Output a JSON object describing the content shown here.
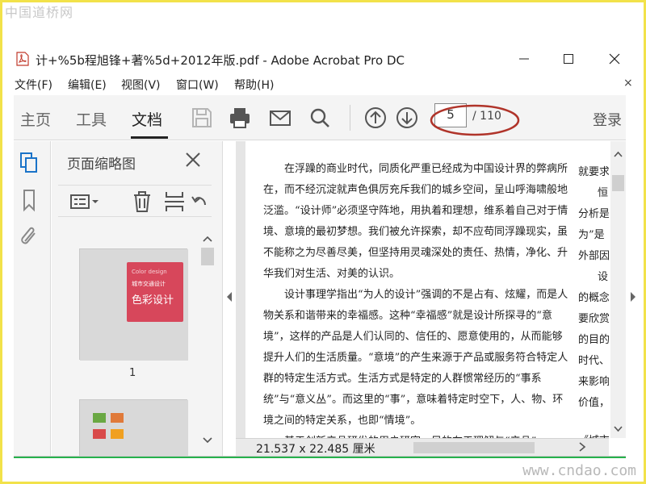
{
  "watermark": {
    "top": "中国道桥网",
    "bottom": "www.cndao.com"
  },
  "window": {
    "title": "计+%5b程旭锋+著%5d+2012年版.pdf - Adobe Acrobat Pro DC",
    "icon": "pdf-file-icon"
  },
  "menu": {
    "items": [
      "文件(F)",
      "编辑(E)",
      "视图(V)",
      "窗口(W)",
      "帮助(H)"
    ],
    "close": "×"
  },
  "toolbar": {
    "tabs": [
      "主页",
      "工具",
      "文档"
    ],
    "active_tab": "文档",
    "icons": [
      "save-icon",
      "print-icon",
      "email-icon",
      "search-icon",
      "page-up-icon",
      "page-down-icon"
    ],
    "page_number": "5",
    "page_total": "/ 110",
    "login": "登录"
  },
  "colors": {
    "annotation": "#b0342a",
    "brand_green": "#26b14c",
    "frame": "#f2e24a"
  },
  "sidebar": {
    "icons": [
      "page-thumbnails-icon",
      "bookmark-icon",
      "attachment-icon"
    ],
    "panel_title": "页面缩略图",
    "tools": [
      "thumbnail-options-icon",
      "delete-page-icon",
      "extract-page-icon",
      "rotate-page-icon"
    ],
    "thumbnails": [
      {
        "label": "1",
        "cover_subtitle": "Color design",
        "cover_line": "城市交通设计",
        "cover_title": "色彩设计"
      }
    ]
  },
  "document": {
    "paragraphs": [
      "在浮躁的商业时代，同质化严重已经成为中国设计界的弊病所在，而不经沉淀就声色俱厉充斥我们的城乡空间，呈山呼海啸般地泛滥。“设计师”必须坚守阵地，用执着和理想，维系着自己对于情境、意境的最初梦想。我们被允许探索，却不应苟同浮躁现实，虽不能称之为尽善尽美，但坚持用灵魂深处的责任、热情，净化、升华我们对生活、对美的认识。",
      "设计事理学指出“为人的设计”强调的不是占有、炫耀，而是人物关系和谐带来的幸福感。这种“幸福感”就是设计所探寻的“意境”，这样的产品是人们认同的、信任的、愿意使用的，从而能够提升人们的生活质量。“意境”的产生来源于产品或服务符合特定人群的特定生活方式。生活方式是特定的人群惯常经历的“事系统”与“意义丛”。而这里的“事”，意味着特定时空下，人、物、环境之间的特定关系，也即“情境”。",
      "基于创新产品研发的用户研究，目的在于理解与“产品”"
    ],
    "next_page_lines": [
      "就要求",
      "恒",
      "分析是",
      "为”是",
      "外部因",
      "设",
      "的概念",
      "要欣赏",
      "的目的",
      "时代、",
      "来影响",
      "价值，",
      "《城市"
    ],
    "dimensions": "21.537 x 22.485 厘米"
  }
}
